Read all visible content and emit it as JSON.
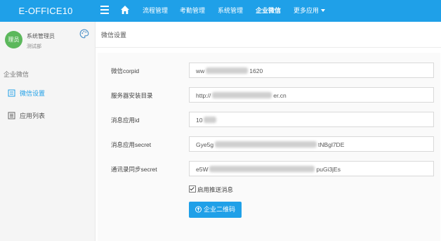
{
  "app": {
    "logo": "E-OFFICE10"
  },
  "topnav": {
    "items": [
      {
        "label": "流程管理"
      },
      {
        "label": "考勤管理"
      },
      {
        "label": "系统管理"
      },
      {
        "label": "企业微信"
      },
      {
        "label": "更多应用"
      }
    ]
  },
  "user": {
    "avatar_text": "理员",
    "name": "系统管理员",
    "dept": "测试部"
  },
  "sidebar": {
    "section": "企业微信",
    "items": [
      {
        "label": "微信设置",
        "icon": "settings-icon"
      },
      {
        "label": "应用列表",
        "icon": "list-icon"
      }
    ]
  },
  "page": {
    "title": "微信设置"
  },
  "form": {
    "fields": [
      {
        "label": "微信corpid",
        "value_start": "ww",
        "value_end": "1620"
      },
      {
        "label": "服务器安装目录",
        "value_start": "http://",
        "value_end": "er.cn"
      },
      {
        "label": "消息应用id",
        "value_start": "10",
        "value_end": ""
      },
      {
        "label": "消息应用secret",
        "value_start": "Gye5g",
        "value_end": "tNBgl7DE"
      },
      {
        "label": "通讯录同步secret",
        "value_start": "e5W",
        "value_end": "puGi3jEs"
      }
    ],
    "checkbox_label": "启用推送消息",
    "checkbox_checked": true,
    "qr_button_label": "企业二维码"
  },
  "colors": {
    "primary": "#1fa0e8",
    "avatar": "#5cb85c"
  }
}
